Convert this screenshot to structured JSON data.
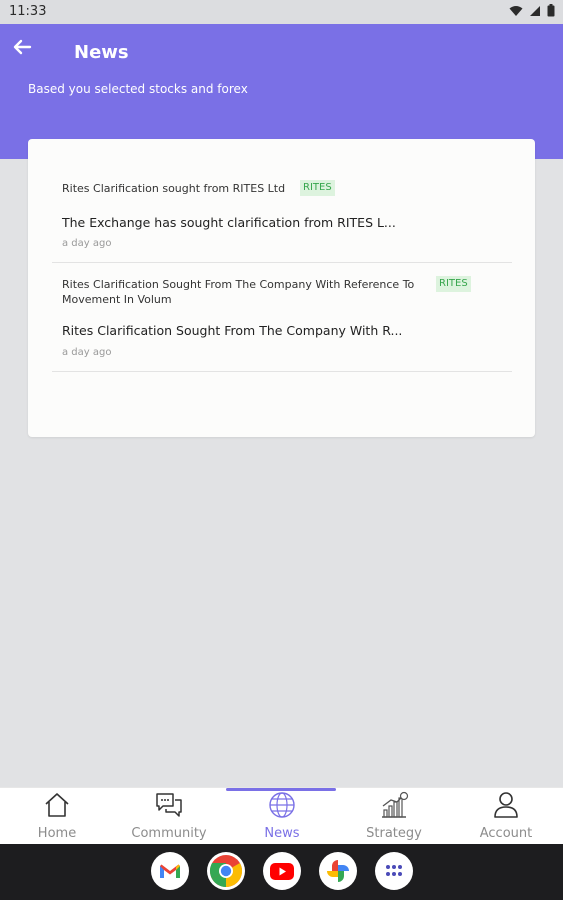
{
  "status_bar": {
    "time": "11:33"
  },
  "header": {
    "title": "News",
    "subtitle": "Based you selected stocks and forex"
  },
  "news": [
    {
      "title": "Rites Clarification sought from RITES Ltd",
      "tag": "RITES",
      "description": "The Exchange has sought clarification from RITES L...",
      "time": "a day ago"
    },
    {
      "title": "Rites Clarification Sought From The Company With Reference To Movement In Volum",
      "tag": "RITES",
      "description": "Rites Clarification Sought From The Company With R...",
      "time": "a day ago"
    }
  ],
  "bottom_nav": {
    "items": [
      {
        "label": "Home",
        "icon": "home-icon"
      },
      {
        "label": "Community",
        "icon": "chat-icon"
      },
      {
        "label": "News",
        "icon": "globe-icon",
        "active": true
      },
      {
        "label": "Strategy",
        "icon": "chart-icon"
      },
      {
        "label": "Account",
        "icon": "user-icon"
      }
    ]
  },
  "dock": {
    "apps": [
      "Gmail",
      "Chrome",
      "YouTube",
      "Photos",
      "App drawer"
    ]
  },
  "colors": {
    "accent": "#7a70e6",
    "tag_bg": "#ddf3de",
    "tag_text": "#37a64d"
  }
}
